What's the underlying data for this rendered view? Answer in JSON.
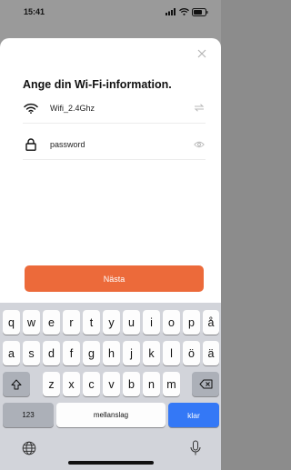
{
  "status_bar": {
    "time": "15:41"
  },
  "sheet": {
    "title": "Ange din Wi-Fi-information.",
    "ssid_value": "Wifi_2.4Ghz",
    "password_placeholder": "password",
    "next_label": "Nästa"
  },
  "accent_color": "#ec6a3a",
  "keyboard": {
    "row1": [
      "q",
      "w",
      "e",
      "r",
      "t",
      "y",
      "u",
      "i",
      "o",
      "p",
      "å"
    ],
    "row2": [
      "a",
      "s",
      "d",
      "f",
      "g",
      "h",
      "j",
      "k",
      "l",
      "ö",
      "ä"
    ],
    "row3": [
      "z",
      "x",
      "c",
      "v",
      "b",
      "n",
      "m"
    ],
    "numbers_label": "123",
    "space_label": "mellanslag",
    "return_label": "klar"
  }
}
